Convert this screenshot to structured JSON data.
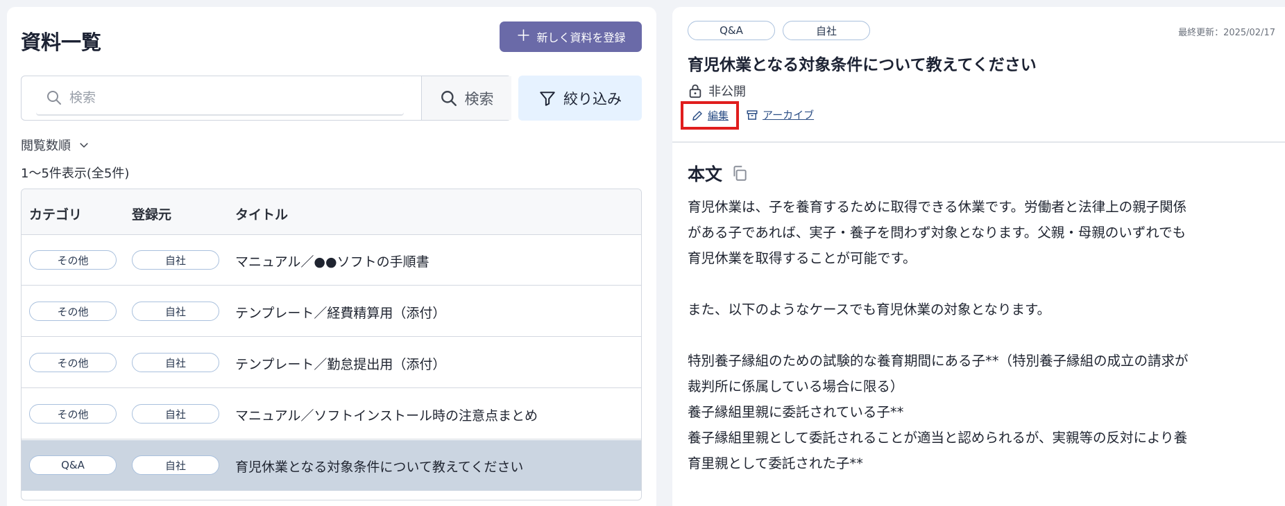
{
  "list": {
    "title": "資料一覧",
    "register_label": "新しく資料を登録",
    "search": {
      "placeholder": "検索",
      "button_label": "検索"
    },
    "filter_label": "絞り込み",
    "sort_label": "閲覧数順",
    "count_text": "1～5件表示(全5件)",
    "columns": {
      "category": "カテゴリ",
      "source": "登録元",
      "title": "タイトル"
    },
    "rows": [
      {
        "category": "その他",
        "source": "自社",
        "title": "マニュアル／●●ソフトの手順書"
      },
      {
        "category": "その他",
        "source": "自社",
        "title": "テンプレート／経費精算用（添付）"
      },
      {
        "category": "その他",
        "source": "自社",
        "title": "テンプレート／勤怠提出用（添付）"
      },
      {
        "category": "その他",
        "source": "自社",
        "title": "マニュアル／ソフトインストール時の注意点まとめ"
      },
      {
        "category": "Q&A",
        "source": "自社",
        "title": "育児休業となる対象条件について教えてください"
      }
    ],
    "selected_index": 4
  },
  "detail": {
    "tags": [
      "Q&A",
      "自社"
    ],
    "updated": "最終更新：2025/02/17",
    "title": "育児休業となる対象条件について教えてください",
    "visibility": "非公開",
    "edit_label": "編集",
    "archive_label": "アーカイブ",
    "body_heading": "本文",
    "body_lines": [
      "育児休業は、子を養育するために取得できる休業です。労働者と法律上の親子関係",
      "がある子であれば、実子・養子を問わず対象となります。父親・母親のいずれでも",
      "育児休業を取得することが可能です。",
      "",
      "また、以下のようなケースでも育児休業の対象となります。",
      "",
      "特別養子縁組のための試験的な養育期間にある子**（特別養子縁組の成立の請求が",
      "裁判所に係属している場合に限る）",
      "養子縁組里親に委託されている子**",
      "養子縁組里親として委託されることが適当と認められるが、実親等の反対により養",
      "育里親として委託された子**"
    ]
  },
  "colors": {
    "accent": "#6a6aa8",
    "selected_row": "#cbd5e1",
    "filter_bg": "#e6f2ff",
    "highlight": "#e01d1d",
    "link": "#2c4f86"
  }
}
